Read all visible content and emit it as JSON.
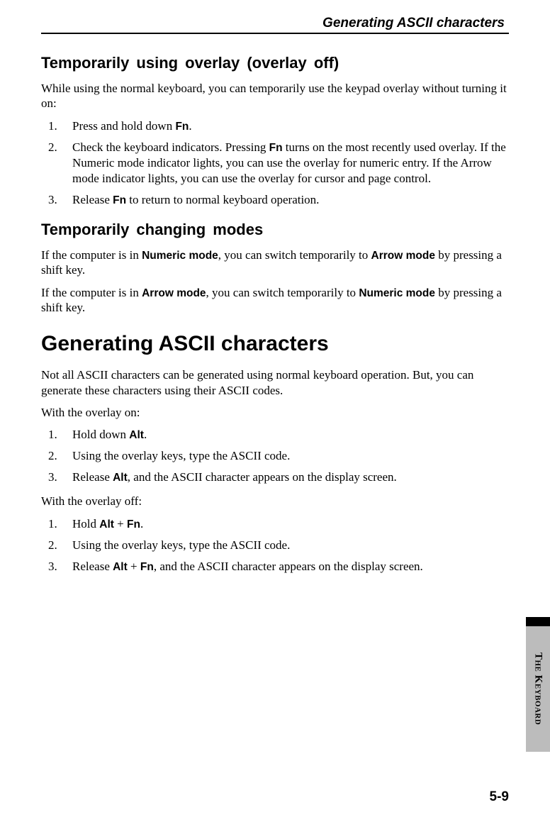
{
  "runningHead": "Generating ASCII characters",
  "section1": {
    "title": "Temporarily using overlay (overlay off)",
    "intro": "While using the normal keyboard, you can temporarily use the keypad overlay without turning it on:",
    "steps": [
      {
        "num": "1.",
        "pre": "Press and hold down ",
        "b1": "Fn",
        "post": "."
      },
      {
        "num": "2.",
        "pre": "Check the keyboard indicators. Pressing ",
        "b1": "Fn",
        "post": " turns on the most recently used overlay. If the Numeric mode indicator lights, you can use the overlay for numeric entry. If the Arrow mode indicator lights, you can use the overlay for cursor and page control."
      },
      {
        "num": "3.",
        "pre": "Release ",
        "b1": "Fn",
        "post": " to return to normal keyboard operation."
      }
    ]
  },
  "section2": {
    "title": "Temporarily changing modes",
    "p1": {
      "pre": "If the computer is in ",
      "b1": "Numeric mode",
      "mid": ", you can switch temporarily to ",
      "b2": "Arrow mode",
      "post": " by pressing a shift key."
    },
    "p2": {
      "pre": "If the computer is in ",
      "b1": "Arrow mode",
      "mid": ", you can switch temporarily to ",
      "b2": "Numeric mode",
      "post": " by pressing a shift key."
    }
  },
  "section3": {
    "title": "Generating ASCII characters",
    "intro": "Not all ASCII characters can be generated using normal keyboard operation. But, you can generate these characters using their ASCII codes.",
    "onLabel": "With the overlay on:",
    "onSteps": [
      {
        "num": "1.",
        "pre": "Hold down ",
        "b1": "Alt",
        "post": "."
      },
      {
        "num": "2.",
        "pre": "Using the overlay keys, type the ASCII code.",
        "b1": "",
        "post": ""
      },
      {
        "num": "3.",
        "pre": "Release ",
        "b1": "Alt",
        "post": ", and the ASCII character appears on the display screen."
      }
    ],
    "offLabel": "With the overlay off:",
    "offSteps": [
      {
        "num": "1.",
        "pre": "Hold ",
        "b1": "Alt",
        "mid": " + ",
        "b2": "Fn",
        "post": "."
      },
      {
        "num": "2.",
        "pre": "Using the overlay keys, type the ASCII code.",
        "b1": "",
        "mid": "",
        "b2": "",
        "post": ""
      },
      {
        "num": "3.",
        "pre": "Release ",
        "b1": "Alt",
        "mid": " + ",
        "b2": "Fn",
        "post": ", and the ASCII character appears on the display screen."
      }
    ]
  },
  "sideTab": "The Keyboard",
  "pageNum": "5-9"
}
